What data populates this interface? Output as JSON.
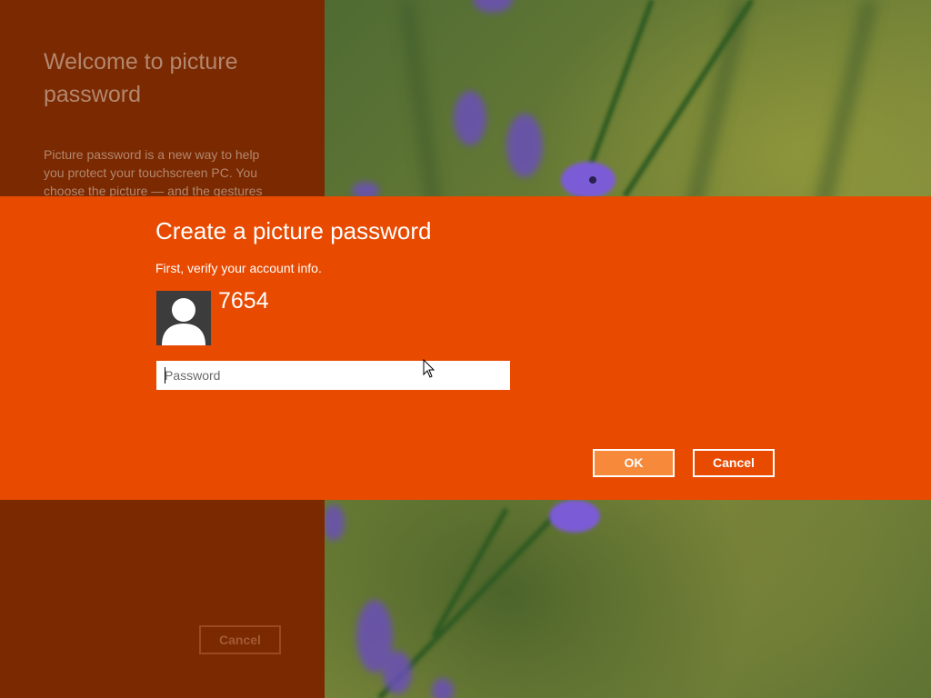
{
  "intro": {
    "title": "Welcome to picture password",
    "text": "Picture password is a new way to help you protect your touchscreen PC. You choose the picture — and the gestures",
    "cancel_label": "Cancel"
  },
  "dialog": {
    "title": "Create a picture password",
    "subtitle": "First, verify your account info.",
    "account_name": "7654",
    "password_placeholder": "Password",
    "ok_label": "OK",
    "cancel_label": "Cancel"
  },
  "colors": {
    "dialog_background": "#e84a00",
    "intro_background": "#7a2900",
    "ok_button": "#f7893b",
    "avatar_background": "#3c3c3c"
  },
  "icons": {
    "avatar": "user-silhouette-icon",
    "cursor": "arrow-cursor-icon"
  }
}
